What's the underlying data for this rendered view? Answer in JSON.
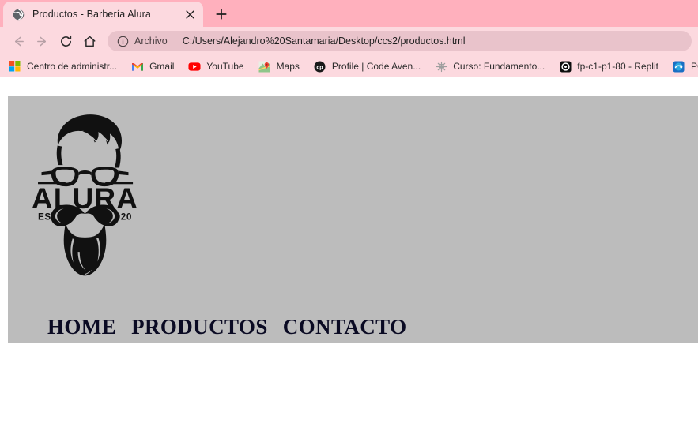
{
  "browser": {
    "tab": {
      "title": "Productos - Barbería Alura",
      "favicon": "globe-icon",
      "close": "×"
    },
    "new_tab_label": "+",
    "toolbar": {
      "back": "back-arrow-icon",
      "forward": "forward-arrow-icon",
      "reload": "reload-icon",
      "home": "home-icon",
      "omnibox": {
        "info_icon": "info-circle-icon",
        "scheme_label": "Archivo",
        "url": "C:/Users/Alejandro%20Santamaria/Desktop/ccs2/productos.html"
      }
    },
    "bookmarks": [
      {
        "label": "Centro de administr...",
        "icon": "microsoft-icon"
      },
      {
        "label": "Gmail",
        "icon": "gmail-icon"
      },
      {
        "label": "YouTube",
        "icon": "youtube-icon"
      },
      {
        "label": "Maps",
        "icon": "google-maps-icon"
      },
      {
        "label": "Profile | Code Aven...",
        "icon": "code-avengers-icon"
      },
      {
        "label": "Curso: Fundamento...",
        "icon": "asterisk-icon"
      },
      {
        "label": "fp-c1-p1-80 - Replit",
        "icon": "replit-icon"
      },
      {
        "label": "PC",
        "icon": "blue-disc-icon"
      }
    ]
  },
  "page": {
    "logo": {
      "brand_text": "ALURA",
      "established_label": "ESTD",
      "established_year": "2020",
      "description": "barbershop-hipster-face-logo"
    },
    "nav": [
      {
        "label": "HOME"
      },
      {
        "label": "PRODUCTOS"
      },
      {
        "label": "CONTACTO"
      }
    ]
  },
  "colors": {
    "tab_strip": "#ffb0bd",
    "active_tab": "#fcd9df",
    "toolbar": "#fcd9df",
    "omnibox": "#e9c3cb",
    "page_header_bg": "#bcbcbc",
    "nav_text": "#0a0a23",
    "logo_black": "#111111"
  }
}
